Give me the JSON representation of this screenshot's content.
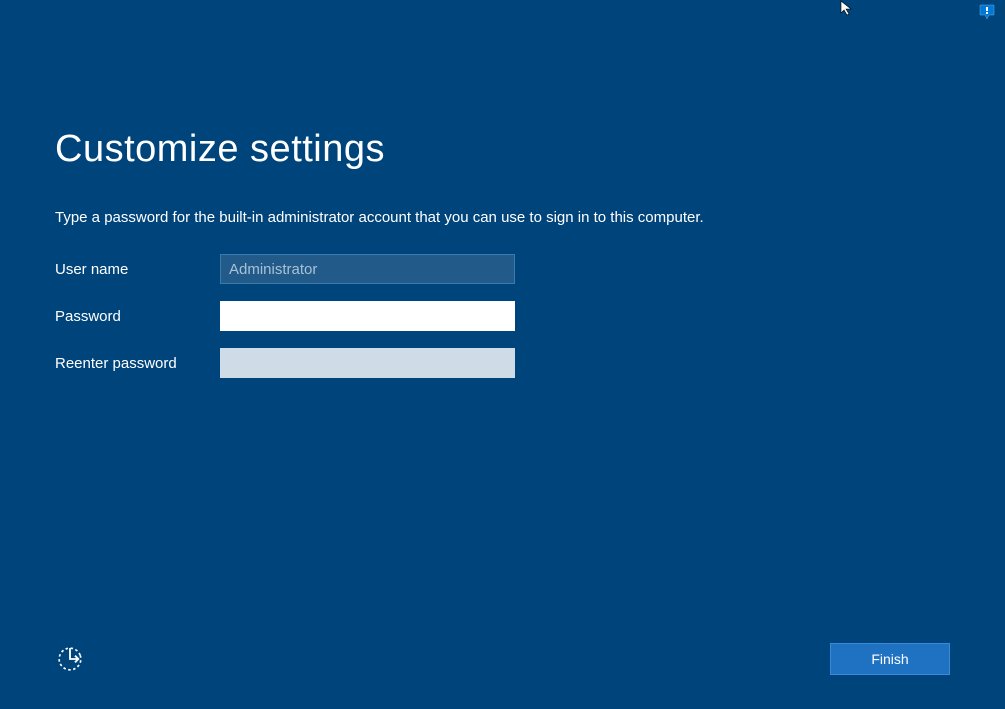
{
  "header": {
    "title": "Customize settings",
    "instruction": "Type a password for the built-in administrator account that you can use to sign in to this computer."
  },
  "form": {
    "username_label": "User name",
    "username_value": "Administrator",
    "password_label": "Password",
    "password_value": "",
    "reenter_label": "Reenter password",
    "reenter_value": ""
  },
  "footer": {
    "finish_label": "Finish"
  }
}
